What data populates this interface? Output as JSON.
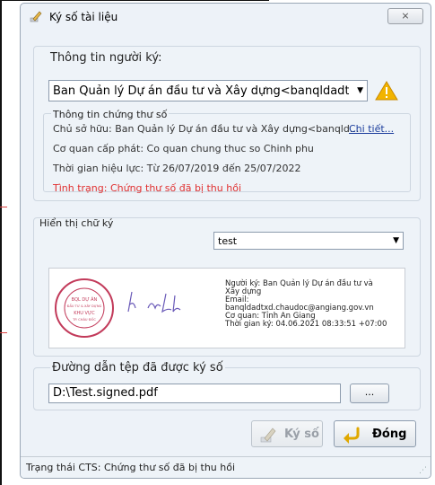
{
  "window": {
    "title": "Ký số tài liệu",
    "close_label": "⨯"
  },
  "signer_group": {
    "label": "Thông tin người ký:",
    "selected_signer": "Ban Quản lý Dự án đầu tư và Xây dựng<banqldadtxd.c",
    "cert_section_label": "Thông tin chứng thư số",
    "owner": "Chủ sở hữu: Ban Quản lý Dự án đầu tư và Xây dựng<banqld...",
    "details_link": "Chi tiết...",
    "issuer": "Cơ quan cấp phát: Co quan chung thuc so Chinh phu",
    "validity": "Thời gian hiệu lực: Từ 26/07/2019 đến 25/07/2022",
    "status": "Tình trạng: Chứng thư số đã bị thu hồi"
  },
  "display_group": {
    "label": "Hiển thị chữ ký",
    "selected_template": "test",
    "preview": {
      "signer_line1": "Người ký: Ban Quản lý Dự án đầu tư và",
      "signer_line2": "Xây dựng",
      "email_label": "Email:",
      "email": "banqldadtxd.chaudoc@angiang.gov.vn",
      "agency": "Cơ quan: Tỉnh An Giang",
      "time": "Thời gian ký: 04.06.2021 08:33:51 +07:00",
      "stamp_lines": [
        "BQL DỰ ÁN",
        "ĐẦU TƯ & XÂY DỰNG",
        "KHU VỰC",
        "TP. CHÂU ĐỐC"
      ]
    }
  },
  "output_group": {
    "label": "Đường dẫn tệp đã được ký số",
    "path_value": "D:\\Test.signed.pdf",
    "browse_label": "..."
  },
  "actions": {
    "sign_label": "Ký số",
    "close_label": "Đóng"
  },
  "statusbar": {
    "text": "Trạng thái CTS: Chứng thư số đã bị thu hồi"
  },
  "colors": {
    "status_red": "#e03030",
    "link_blue": "#1a3c9c",
    "stamp_red": "#c23a5a"
  }
}
